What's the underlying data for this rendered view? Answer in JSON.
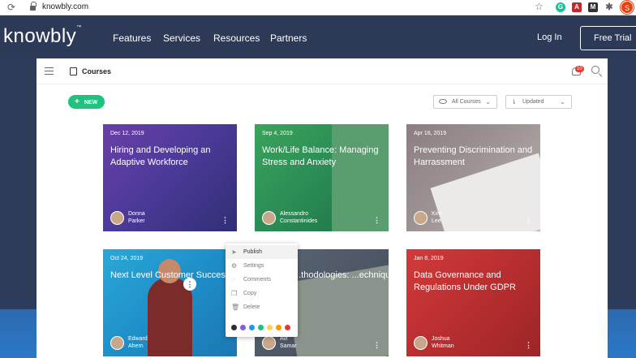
{
  "browser": {
    "url": "knowbly.com",
    "avatar_letter": "S"
  },
  "site": {
    "logo": "knowbly",
    "logo_tm": "™",
    "nav": [
      "Features",
      "Services",
      "Resources",
      "Partners"
    ],
    "login": "Log In",
    "cta": "Free Trial"
  },
  "app": {
    "title": "Courses",
    "notif_count": "10",
    "new_label": "NEW",
    "filter_all": "All Courses",
    "filter_sort": "Updated"
  },
  "cards": [
    {
      "date": "Dec 12, 2019",
      "title": "Hiring and Developing an Adaptive Workforce",
      "author_first": "Donna",
      "author_last": "Parker"
    },
    {
      "date": "Sep 4, 2019",
      "title": "Work/Life Balance: Managing Stress and Anxiety",
      "author_first": "Alessandro",
      "author_last": "Constantinides"
    },
    {
      "date": "Apr 16, 2019",
      "title": "Preventing Discrimination and Harrassment",
      "author_first": "Kim",
      "author_last": "Lee"
    },
    {
      "date": "Oct 24, 2019",
      "title": "Next Level Customer Success",
      "author_first": "Edward",
      "author_last": "Ahern"
    },
    {
      "date": "",
      "title": "...thodologies: ...echniques",
      "author_first": "Avi",
      "author_last": "Samar"
    },
    {
      "date": "Jan 8, 2019",
      "title": "Data Governance and Regulations Under GDPR",
      "author_first": "Joshua",
      "author_last": "Whitman"
    }
  ],
  "menu": {
    "items": [
      "Publish",
      "Settings",
      "Comments",
      "Copy",
      "Delete"
    ],
    "colors": [
      "#2b2b3a",
      "#8b5bd6",
      "#2196f3",
      "#1fc27e",
      "#ffd54f",
      "#ff9800",
      "#e53935"
    ]
  }
}
